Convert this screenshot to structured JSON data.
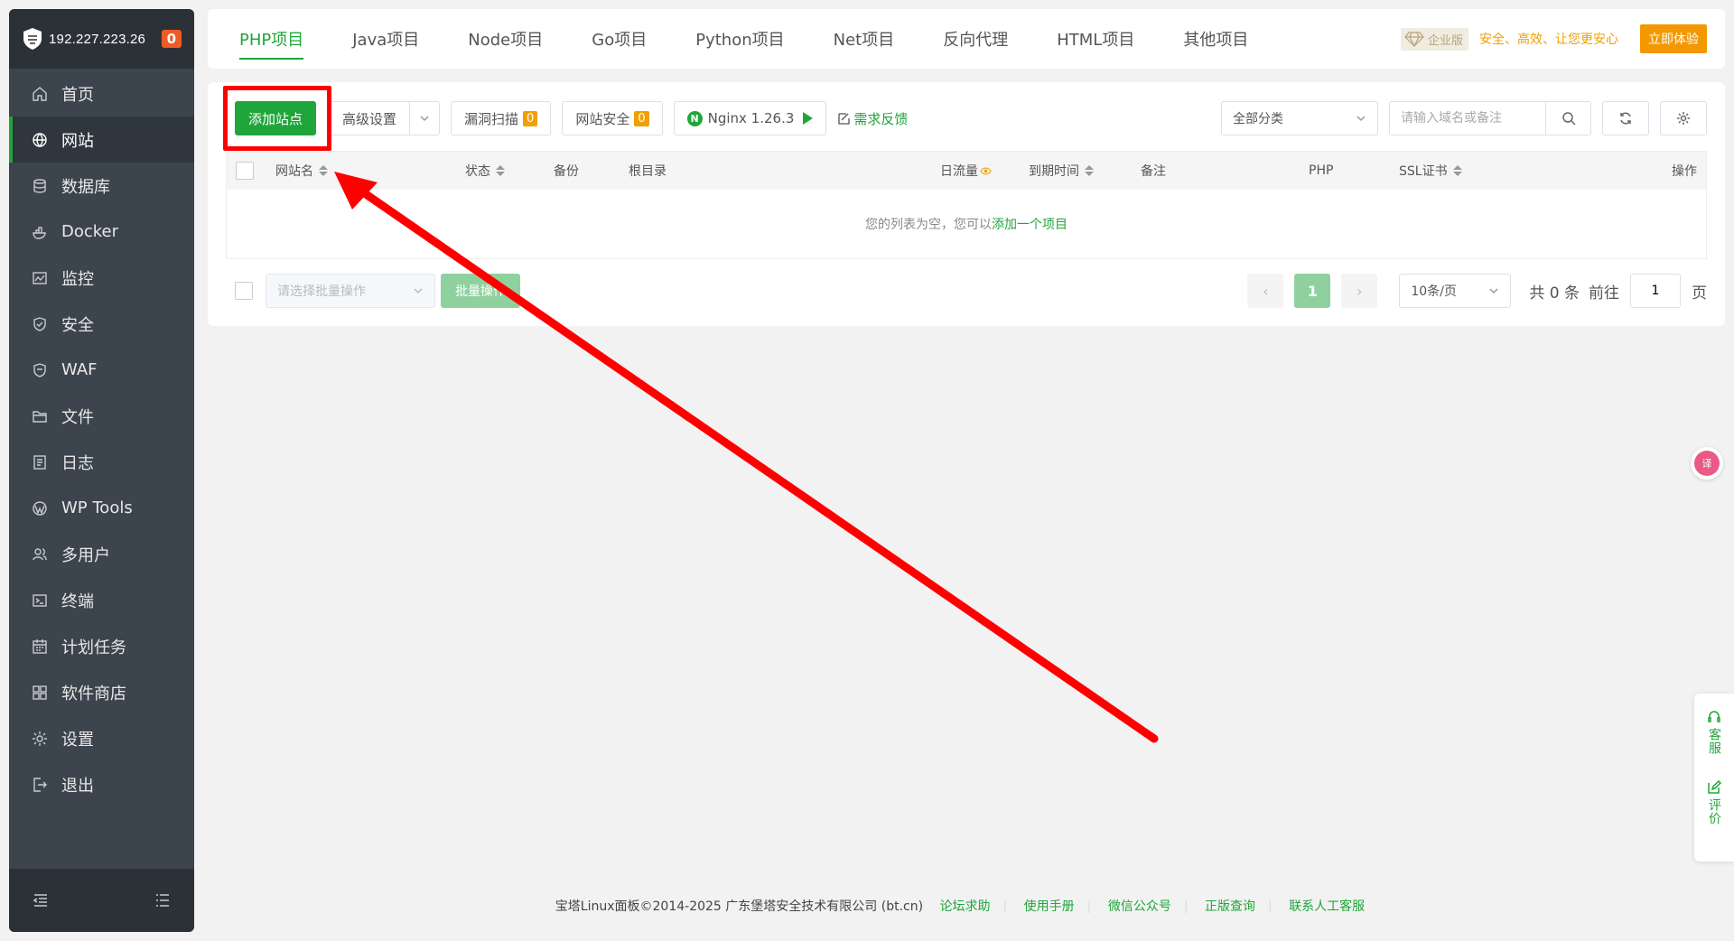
{
  "sidebar": {
    "ip": "192.227.223.26",
    "badge": "0",
    "items": [
      {
        "label": "首页",
        "icon": "home-icon"
      },
      {
        "label": "网站",
        "icon": "globe-icon"
      },
      {
        "label": "数据库",
        "icon": "database-icon"
      },
      {
        "label": "Docker",
        "icon": "docker-icon"
      },
      {
        "label": "监控",
        "icon": "monitor-icon"
      },
      {
        "label": "安全",
        "icon": "shield-icon"
      },
      {
        "label": "WAF",
        "icon": "waf-icon"
      },
      {
        "label": "文件",
        "icon": "folder-icon"
      },
      {
        "label": "日志",
        "icon": "log-icon"
      },
      {
        "label": "WP Tools",
        "icon": "wordpress-icon"
      },
      {
        "label": "多用户",
        "icon": "users-icon"
      },
      {
        "label": "终端",
        "icon": "terminal-icon"
      },
      {
        "label": "计划任务",
        "icon": "calendar-icon"
      },
      {
        "label": "软件商店",
        "icon": "grid-icon"
      },
      {
        "label": "设置",
        "icon": "gear-icon"
      },
      {
        "label": "退出",
        "icon": "logout-icon"
      }
    ],
    "active_index": 1
  },
  "tabs": [
    "PHP项目",
    "Java项目",
    "Node项目",
    "Go项目",
    "Python项目",
    "Net项目",
    "反向代理",
    "HTML项目",
    "其他项目"
  ],
  "promo": {
    "edition": "企业版",
    "slogan": "安全、高效、让您更安心",
    "cta": "立即体验"
  },
  "toolbar": {
    "add_site": "添加站点",
    "advanced": "高级设置",
    "vuln_scan": "漏洞扫描",
    "vuln_count": "0",
    "site_security": "网站安全",
    "security_count": "0",
    "nginx": "Nginx 1.26.3",
    "feedback": "需求反馈",
    "category": "全部分类",
    "search_placeholder": "请输入域名或备注"
  },
  "table": {
    "columns": [
      "网站名",
      "状态",
      "备份",
      "根目录",
      "日流量",
      "到期时间",
      "备注",
      "PHP",
      "SSL证书",
      "操作"
    ],
    "empty_text": "您的列表为空，您可以",
    "empty_link": "添加一个项目"
  },
  "bottom": {
    "batch_placeholder": "请选择批量操作",
    "batch_btn": "批量操作",
    "current_page": "1",
    "page_size": "10条/页",
    "total": "共 0 条",
    "goto_label": "前往",
    "goto_value": "1",
    "page_unit": "页"
  },
  "footer": {
    "copyright": "宝塔Linux面板©2014-2025 广东堡塔安全技术有限公司 (bt.cn)",
    "links": [
      "论坛求助",
      "使用手册",
      "微信公众号",
      "正版查询",
      "联系人工客服"
    ]
  },
  "float": {
    "translate": "译",
    "service": "客服",
    "review": "评价"
  },
  "colors": {
    "accent": "#20a53a",
    "sidebar": "#3c444d",
    "warning": "#f0a000",
    "annotation": "#ff0000"
  }
}
